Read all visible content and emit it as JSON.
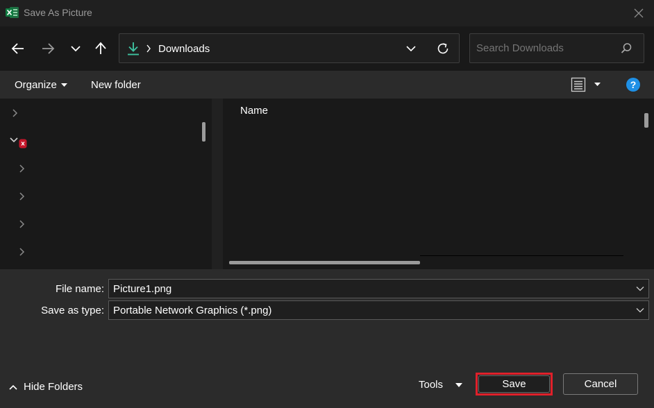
{
  "window": {
    "title": "Save As Picture"
  },
  "address": {
    "current": "Downloads"
  },
  "search": {
    "placeholder": "Search Downloads"
  },
  "toolbar": {
    "organize": "Organize",
    "new_folder": "New folder"
  },
  "filelist": {
    "column_name": "Name"
  },
  "form": {
    "filename_label": "File name:",
    "filename_value": "Picture1.png",
    "savetype_label": "Save as type:",
    "savetype_value": "Portable Network Graphics (*.png)"
  },
  "footer": {
    "hide_folders": "Hide Folders",
    "tools": "Tools",
    "save": "Save",
    "cancel": "Cancel"
  },
  "colors": {
    "accent_download": "#3ec2a0",
    "help_blue": "#1e90e6",
    "highlight_red": "#e0202a",
    "error_badge": "#c4162a"
  }
}
